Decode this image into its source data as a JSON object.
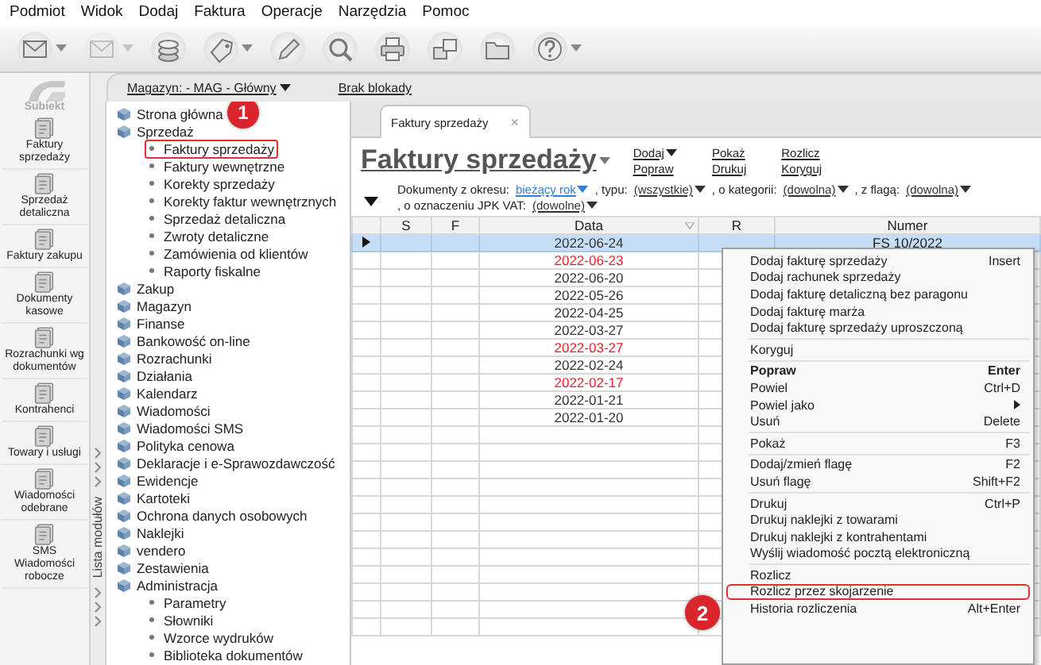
{
  "menu_bar": [
    "Podmiot",
    "Widok",
    "Dodaj",
    "Faktura",
    "Operacje",
    "Narzędzia",
    "Pomoc"
  ],
  "toolbar": [
    {
      "kind": "envelope",
      "dropdown": true,
      "disabled": false
    },
    {
      "kind": "envelope",
      "dropdown": true,
      "disabled": true
    },
    {
      "kind": "coins",
      "dropdown": false,
      "disabled": false
    },
    {
      "kind": "tag",
      "dropdown": true,
      "disabled": false
    },
    {
      "kind": "pen",
      "dropdown": false,
      "disabled": false
    },
    {
      "kind": "magnifier",
      "dropdown": false,
      "disabled": false
    },
    {
      "kind": "printer",
      "dropdown": false,
      "disabled": false
    },
    {
      "kind": "boxes",
      "dropdown": false,
      "disabled": false
    },
    {
      "kind": "folder",
      "dropdown": false,
      "disabled": false
    },
    {
      "kind": "help",
      "dropdown": true,
      "disabled": false
    }
  ],
  "sidebar": {
    "logo": "Subiekt",
    "items": [
      {
        "label": "Faktury sprzedaży"
      },
      {
        "label": "Sprzedaż detaliczna"
      },
      {
        "label": "Faktury zakupu"
      },
      {
        "label": "Dokumenty kasowe"
      },
      {
        "label": "Rozrachunki wg dokumentów"
      },
      {
        "label": "Kontrahenci"
      },
      {
        "label": "Towary i usługi"
      },
      {
        "label": "Wiadomości odebrane"
      },
      {
        "label": "SMS Wiadomości robocze"
      }
    ]
  },
  "topbar": [
    {
      "label": "Magazyn: - MAG - Główny",
      "dropdown": true
    },
    {
      "label": "Brak blokady",
      "dropdown": false
    }
  ],
  "module_strip": {
    "title": "Lista modułów"
  },
  "tree": [
    {
      "label": "Strona główna",
      "outlined": false
    },
    {
      "label": "Sprzedaż",
      "outlined": false,
      "children": [
        {
          "label": "Faktury sprzedaży",
          "outlined": true
        },
        {
          "label": "Faktury wewnętrzne",
          "outlined": false
        },
        {
          "label": "Korekty sprzedaży",
          "outlined": false
        },
        {
          "label": "Korekty faktur wewnętrznych",
          "outlined": false
        },
        {
          "label": "Sprzedaż detaliczna",
          "outlined": false
        },
        {
          "label": "Zwroty detaliczne",
          "outlined": false
        },
        {
          "label": "Zamówienia od klientów",
          "outlined": false
        },
        {
          "label": "Raporty fiskalne",
          "outlined": false
        }
      ]
    },
    {
      "label": "Zakup",
      "outlined": false
    },
    {
      "label": "Magazyn",
      "outlined": false
    },
    {
      "label": "Finanse",
      "outlined": false
    },
    {
      "label": "Bankowość on-line",
      "outlined": false
    },
    {
      "label": "Rozrachunki",
      "outlined": false
    },
    {
      "label": "Działania",
      "outlined": false
    },
    {
      "label": "Kalendarz",
      "outlined": false
    },
    {
      "label": "Wiadomości",
      "outlined": false
    },
    {
      "label": "Wiadomości SMS",
      "outlined": false
    },
    {
      "label": "Polityka cenowa",
      "outlined": false
    },
    {
      "label": "Deklaracje i e-Sprawozdawczość",
      "outlined": false
    },
    {
      "label": "Ewidencje",
      "outlined": false
    },
    {
      "label": "Kartoteki",
      "outlined": false
    },
    {
      "label": "Ochrona danych osobowych",
      "outlined": false
    },
    {
      "label": "Naklejki",
      "outlined": false
    },
    {
      "label": "vendero",
      "outlined": false
    },
    {
      "label": "Zestawienia",
      "outlined": false
    },
    {
      "label": "Administracja",
      "outlined": false,
      "children": [
        {
          "label": "Parametry",
          "outlined": false
        },
        {
          "label": "Słowniki",
          "outlined": false
        },
        {
          "label": "Wzorce wydruków",
          "outlined": false
        },
        {
          "label": "Biblioteka dokumentów",
          "outlined": false
        }
      ]
    }
  ],
  "document": {
    "tab": {
      "label": "Faktury sprzedaży",
      "close": "×",
      "selected": true
    },
    "title": {
      "text": "Faktury sprzedaży",
      "dropdown": true
    },
    "actions": [
      {
        "label": "Dodaj",
        "dropdown": true
      },
      {
        "label": "Pokaż",
        "dropdown": false
      },
      {
        "label": "Rozlicz",
        "dropdown": false
      },
      {
        "label": "Popraw",
        "dropdown": false
      },
      {
        "label": "Drukuj",
        "dropdown": false
      },
      {
        "label": "Koryguj",
        "dropdown": false
      }
    ],
    "filters": [
      [
        {
          "kind": "label",
          "text": "Dokumenty z okresu:"
        },
        {
          "kind": "link",
          "text": "bieżący rok",
          "color": "#2f7fd8"
        },
        {
          "kind": "label",
          "text": ", typu:"
        },
        {
          "kind": "link",
          "text": "(wszystkie)",
          "color": "#333333"
        },
        {
          "kind": "label",
          "text": ", o kategorii:"
        },
        {
          "kind": "link",
          "text": "(dowolna)",
          "color": "#333333"
        },
        {
          "kind": "label",
          "text": ", z flagą:"
        },
        {
          "kind": "link",
          "text": "(dowolna)",
          "color": "#333333"
        }
      ],
      [
        {
          "kind": "label",
          "text": ", o oznaczeniu JPK VAT:"
        },
        {
          "kind": "link",
          "text": "(dowolne)",
          "color": "#333333"
        }
      ]
    ],
    "grid": {
      "columns": [
        "S",
        "F",
        "Data",
        "R",
        "Numer"
      ],
      "rows": [
        {
          "date": "2022-06-24",
          "number": "FS 10/2022",
          "color": "#333333",
          "selected": true
        },
        {
          "date": "2022-06-23",
          "color": "#e8212a",
          "selected": false
        },
        {
          "date": "2022-06-20",
          "color": "#333333",
          "selected": false
        },
        {
          "date": "2022-05-26",
          "color": "#333333",
          "selected": false
        },
        {
          "date": "2022-04-25",
          "color": "#333333",
          "selected": false
        },
        {
          "date": "2022-03-27",
          "color": "#333333",
          "selected": false
        },
        {
          "date": "2022-03-27",
          "color": "#e8212a",
          "selected": false
        },
        {
          "date": "2022-02-24",
          "color": "#333333",
          "selected": false
        },
        {
          "date": "2022-02-17",
          "color": "#e8212a",
          "selected": false
        },
        {
          "date": "2022-01-21",
          "color": "#333333",
          "selected": false
        },
        {
          "date": "2022-01-20",
          "color": "#333333",
          "selected": false
        }
      ]
    },
    "context_menu": [
      [
        {
          "label": "Dodaj fakturę sprzedaży",
          "shortcut": "Insert",
          "kind": "item",
          "outlined": false
        },
        {
          "label": "Dodaj rachunek sprzedaży",
          "kind": "item",
          "outlined": false
        },
        {
          "label": "Dodaj fakturę detaliczną bez paragonu",
          "kind": "item",
          "outlined": false
        },
        {
          "label": "Dodaj fakturę marża",
          "kind": "item",
          "outlined": false
        },
        {
          "label": "Dodaj fakturę sprzedaży uproszczoną",
          "kind": "item",
          "outlined": false
        }
      ],
      [
        {
          "label": "Koryguj",
          "kind": "item",
          "outlined": false
        }
      ],
      [
        {
          "label": "Popraw",
          "shortcut": "Enter",
          "kind": "default",
          "outlined": false
        },
        {
          "label": "Powiel",
          "shortcut": "Ctrl+D",
          "kind": "item",
          "outlined": false
        },
        {
          "label": "Powiel jako",
          "kind": "submenu",
          "outlined": false
        },
        {
          "label": "Usuń",
          "shortcut": "Delete",
          "kind": "item",
          "outlined": false
        }
      ],
      [
        {
          "label": "Pokaż",
          "shortcut": "F3",
          "kind": "item",
          "outlined": false
        }
      ],
      [
        {
          "label": "Dodaj/zmień flagę",
          "shortcut": "F2",
          "kind": "item",
          "outlined": false
        },
        {
          "label": "Usuń flagę",
          "shortcut": "Shift+F2",
          "kind": "item",
          "outlined": false
        }
      ],
      [
        {
          "label": "Drukuj",
          "shortcut": "Ctrl+P",
          "kind": "item",
          "outlined": false
        },
        {
          "label": "Drukuj naklejki z towarami",
          "kind": "item",
          "outlined": false
        },
        {
          "label": "Drukuj naklejki z kontrahentami",
          "kind": "item",
          "outlined": false
        },
        {
          "label": "Wyślij wiadomość pocztą elektroniczną",
          "kind": "item",
          "outlined": false
        }
      ],
      [
        {
          "label": "Rozlicz",
          "kind": "item",
          "outlined": false
        },
        {
          "label": "Rozlicz przez skojarzenie",
          "kind": "item",
          "outlined": true
        },
        {
          "label": "Historia rozliczenia",
          "shortcut": "Alt+Enter",
          "kind": "item",
          "outlined": false
        }
      ]
    ]
  },
  "callouts": [
    {
      "number": "1"
    },
    {
      "number": "2"
    }
  ]
}
